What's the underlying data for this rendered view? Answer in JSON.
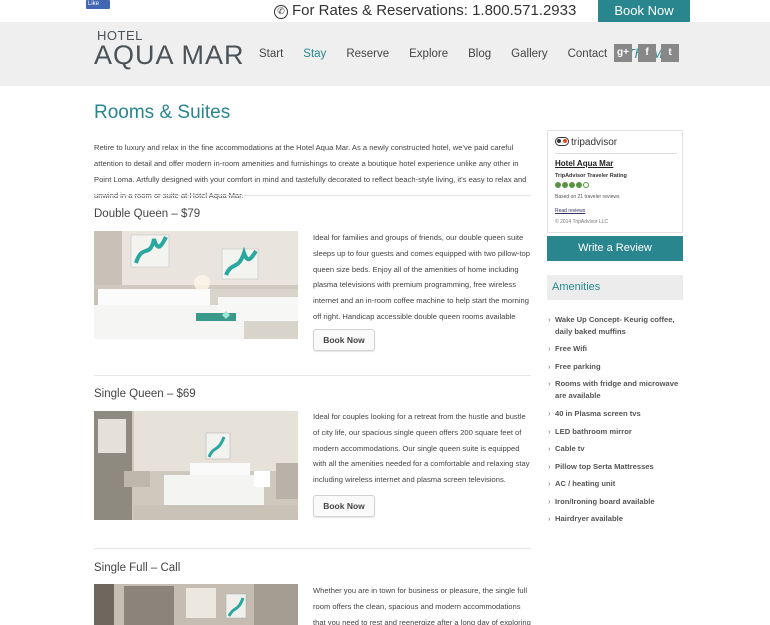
{
  "topbar": {
    "facebook_like": "Like",
    "rates_text": "For Rates & Reservations: 1.800.571.2933",
    "book_now": "Book Now"
  },
  "header": {
    "logo_small": "HOTEL",
    "logo_big": "AQUA MAR",
    "nav": [
      "Start",
      "Stay",
      "Reserve",
      "Explore",
      "Blog",
      "Gallery",
      "Contact",
      "The Mar"
    ],
    "social": [
      "g+",
      "f",
      "t"
    ]
  },
  "main": {
    "title": "Rooms & Suites",
    "intro": "Retire to luxury and relax in the fine accommodations at the Hotel Aqua Mar. As a newly constructed hotel, we've paid careful attention to detail and offer modern in-room amenities and furnishings to create a boutique hotel experience unlike any other in Point Loma. Artfully designed with your comfort in mind and tastefully decorated to reflect beach-style living, it's easy to relax and unwind in a room or suite at Hotel Aqua Mar.",
    "book_label": "Book Now",
    "rooms": [
      {
        "title": "Double Queen – $79",
        "description": "Ideal for families and groups of friends, our double queen suite sleeps up to four guests and comes equipped with two pillow-top queen size beds. Enjoy all of the amenities of home including plasma televisions with premium programming, free wireless internet and an in-room coffee machine to help start the morning off right. Handicap accessible double queen rooms available upon request."
      },
      {
        "title": "Single Queen – $69",
        "description": "Ideal for couples looking for a retreat from the hustle and bustle of city life, our spacious single queen offers 200 square feet of modern accommodations. Our single queen suite is equipped with all the amenities needed for a comfortable and relaxing stay including wireless internet and plasma screen televisions."
      },
      {
        "title": "Single Full – Call",
        "description": "Whether you are in town for business or pleasure, the single full room offers the clean, spacious and modern accommodations that you need to rest and reenergize after a long day of exploring the city. Relax in a pillow"
      }
    ]
  },
  "sidebar": {
    "tripadvisor": {
      "brand": "tripadvisor",
      "hotel": "Hotel Aqua Mar",
      "rating_label": "TripAdvisor Traveler Rating",
      "rating": 4,
      "rating_max": 5,
      "based_on": "Based on 21 traveler reviews",
      "read_reviews": "Read reviews",
      "copyright": "© 2014 TripAdvisor LLC"
    },
    "write_review": "Write a Review",
    "amenities_title": "Amenities",
    "amenities": [
      "Wake Up Concept- Keurig coffee, daily baked muffins",
      "Free Wifi",
      "Free parking",
      "Rooms with fridge and microwave are available",
      "40 in Plasma screen tvs",
      "LED bathroom mirror",
      "Cable tv",
      "Pillow top Serta Mattresses",
      "AC / heating unit",
      "Iron/Ironing board available",
      "Hairdryer available"
    ]
  },
  "colors": {
    "accent": "#29868f",
    "header_bg": "#efefef"
  }
}
